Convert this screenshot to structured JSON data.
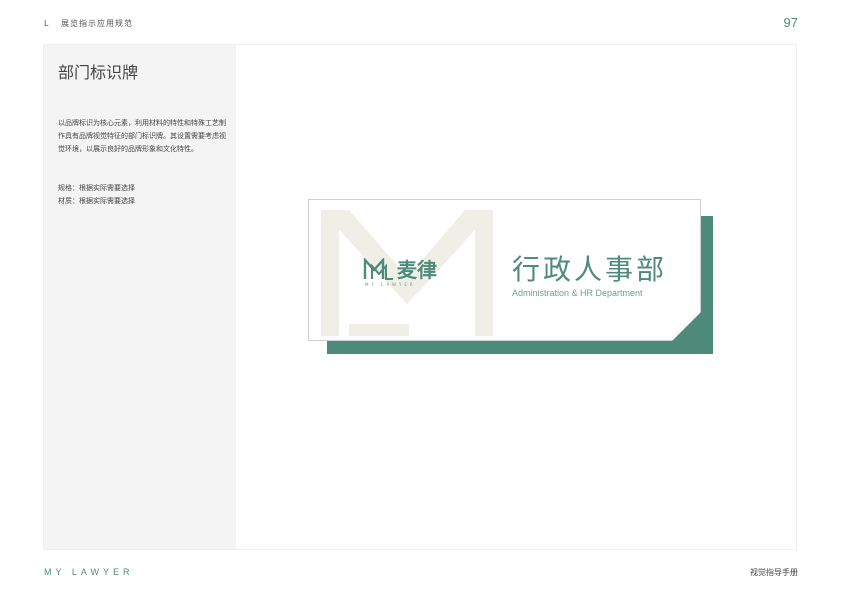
{
  "header": {
    "mark": "L",
    "section": "展览指示应用规范",
    "page_number": "97"
  },
  "sidebar": {
    "title": "部门标识牌",
    "description": "以品牌标识为核心元素，利用材料的特性和特殊工艺制作具有品牌视觉特征的部门标识牌。其设置需要考虑视觉环境，以展示良好的品牌形象和文化特性。",
    "spec_size": "规格：根据实际需要选择",
    "spec_material": "材质：根据实际需要选择"
  },
  "sign": {
    "brand_cn": "麦律",
    "brand_en": "MY LAWYER",
    "department_cn": "行政人事部",
    "department_en": "Administration & HR Department"
  },
  "footer": {
    "brand": "MY LAWYER",
    "manual": "视觉指导手册"
  },
  "colors": {
    "brand_green": "#4e8b7a",
    "sidebar_bg": "#f4f4f4"
  }
}
